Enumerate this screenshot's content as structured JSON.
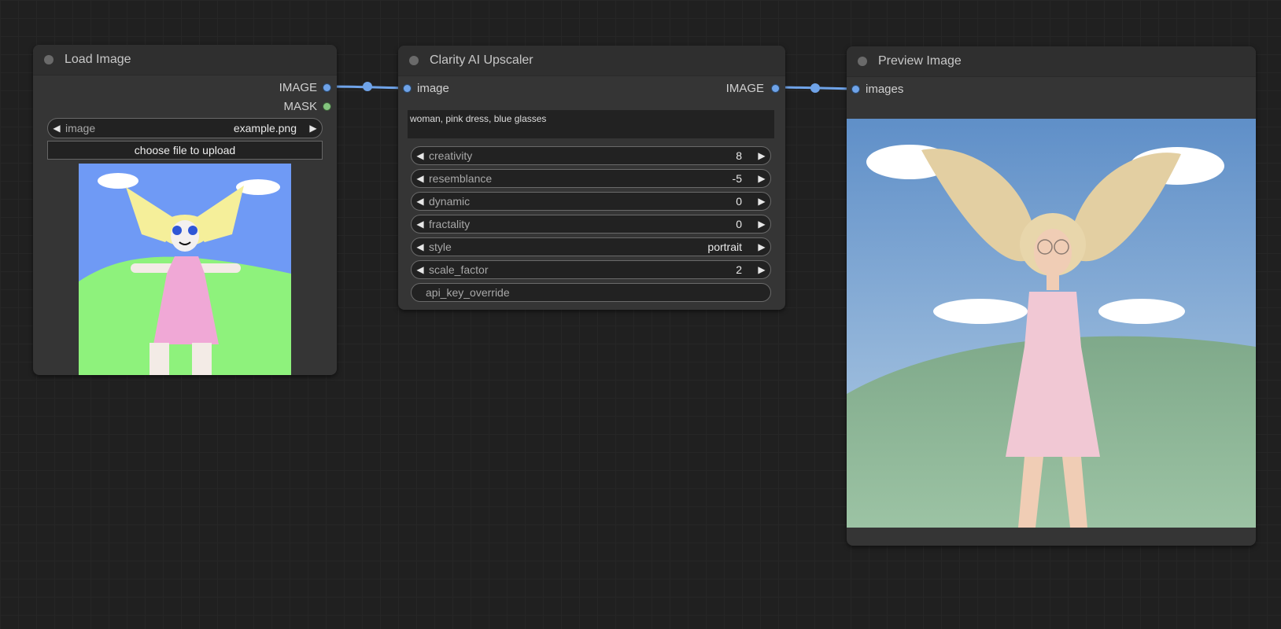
{
  "nodes": {
    "load_image": {
      "title": "Load Image",
      "outputs": [
        "IMAGE",
        "MASK"
      ],
      "widget": {
        "label": "image",
        "value": "example.png"
      },
      "upload_label": "choose file to upload"
    },
    "clarity": {
      "title": "Clarity AI Upscaler",
      "input": "image",
      "output": "IMAGE",
      "prompt": "woman, pink dress, blue glasses",
      "widgets": [
        {
          "label": "creativity",
          "value": "8"
        },
        {
          "label": "resemblance",
          "value": "-5"
        },
        {
          "label": "dynamic",
          "value": "0"
        },
        {
          "label": "fractality",
          "value": "0"
        },
        {
          "label": "style",
          "value": "portrait"
        },
        {
          "label": "scale_factor",
          "value": "2"
        }
      ],
      "api_key_label": "api_key_override"
    },
    "preview": {
      "title": "Preview Image",
      "input": "images"
    }
  },
  "colors": {
    "image_slot": "#6fa3e8",
    "mask_slot": "#84c47e",
    "canvas": "#202020"
  }
}
